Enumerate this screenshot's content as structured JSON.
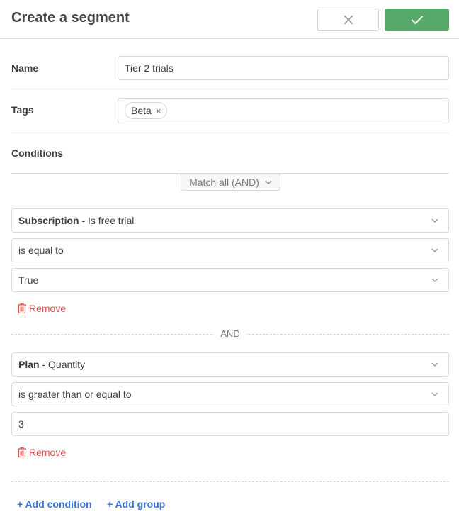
{
  "header": {
    "title": "Create a segment",
    "cancel_icon": "close-icon",
    "save_icon": "check-icon",
    "save_color": "#56a96b"
  },
  "form": {
    "name_label": "Name",
    "name_value": "Tier 2 trials",
    "tags_label": "Tags",
    "tags": [
      {
        "label": "Beta",
        "remove_glyph": "×"
      }
    ],
    "conditions_label": "Conditions",
    "match_mode": "Match all (AND)"
  },
  "conditions": [
    {
      "field_bold": "Subscription",
      "field_rest": " - Is free trial",
      "operator": "is equal to",
      "value": "True",
      "value_is_select": true,
      "remove_label": "Remove"
    },
    {
      "field_bold": "Plan",
      "field_rest": " - Quantity",
      "operator": "is greater than or equal to",
      "value": "3",
      "value_is_select": false,
      "remove_label": "Remove"
    }
  ],
  "joiner": "AND",
  "actions": {
    "add_condition": "+ Add condition",
    "add_group": "+ Add group",
    "link_color": "#3a73d9",
    "remove_color": "#d9534f"
  }
}
